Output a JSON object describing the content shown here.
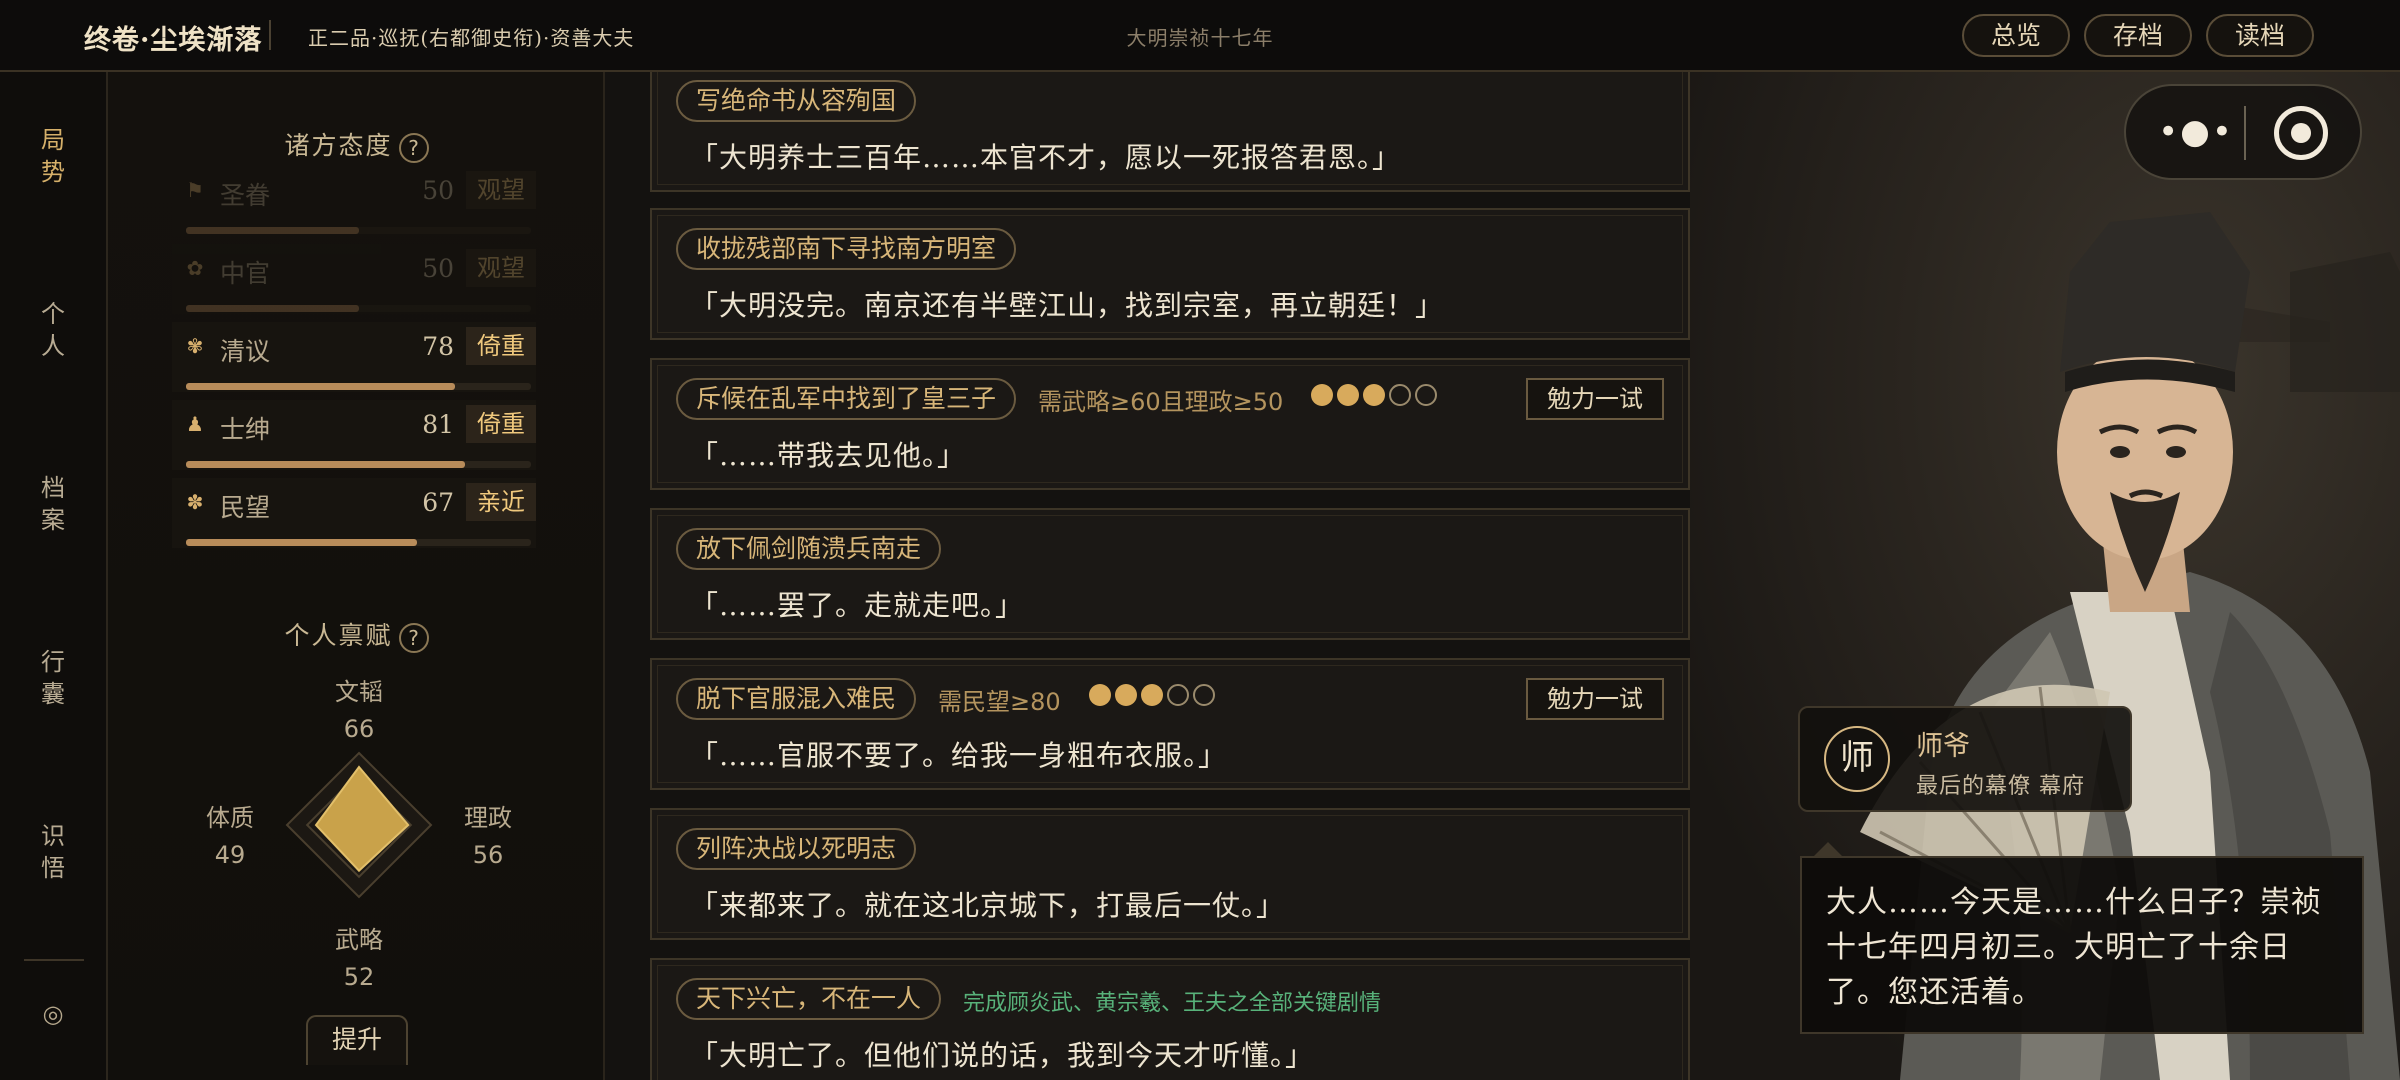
{
  "topbar": {
    "chapter": "终卷·尘埃渐落",
    "rank": "正二品·巡抚(右都御史衔)·资善大夫",
    "era": "大明崇祯十七年",
    "buttons": {
      "overview": "总览",
      "save": "存档",
      "load": "读档"
    }
  },
  "nav": {
    "items": [
      {
        "id": "situation",
        "label": "局\n势",
        "active": true
      },
      {
        "id": "personal",
        "label": "个\n人",
        "active": false
      },
      {
        "id": "archive",
        "label": "档\n案",
        "active": false
      },
      {
        "id": "baggage",
        "label": "行\n囊",
        "active": false
      },
      {
        "id": "insight",
        "label": "识\n悟",
        "active": false
      }
    ],
    "target_icon": "◎"
  },
  "attitudes": {
    "title": "诸方态度",
    "help": "?",
    "factions": [
      {
        "icon": "⚑",
        "name": "圣眷",
        "score": "50",
        "attitude": "观望",
        "level": 0.5,
        "dim": true
      },
      {
        "icon": "✿",
        "name": "中官",
        "score": "50",
        "attitude": "观望",
        "level": 0.5,
        "dim": true
      },
      {
        "icon": "✾",
        "name": "清议",
        "score": "78",
        "attitude": "倚重",
        "level": 0.78,
        "dim": false
      },
      {
        "icon": "♟",
        "name": "士绅",
        "score": "81",
        "attitude": "倚重",
        "level": 0.81,
        "dim": false
      },
      {
        "icon": "✽",
        "name": "民望",
        "score": "67",
        "attitude": "亲近",
        "level": 0.67,
        "dim": false
      }
    ]
  },
  "talents": {
    "title": "个人禀赋",
    "help": "?",
    "stats": {
      "wentao": {
        "label": "文韬",
        "value": "66"
      },
      "lizheng": {
        "label": "理政",
        "value": "56"
      },
      "wulue": {
        "label": "武略",
        "value": "52"
      },
      "tizhi": {
        "label": "体质",
        "value": "49"
      }
    },
    "upgrade": "提升"
  },
  "choices": [
    {
      "tag": "写绝命书从容殉国",
      "quote": "「大明养士三百年……本官不才，愿以一死报答君恩。」"
    },
    {
      "tag": "收拢残部南下寻找南方明室",
      "quote": "「大明没完。南京还有半壁江山，找到宗室，再立朝廷！」"
    },
    {
      "tag": "斥候在乱军中找到了皇三子",
      "requirement": "需武略≥60且理政≥50",
      "difficulty": 3,
      "difficulty_max": 5,
      "action": "勉力一试",
      "quote": "「……带我去见他。」"
    },
    {
      "tag": "放下佩剑随溃兵南走",
      "quote": "「……罢了。走就走吧。」"
    },
    {
      "tag": "脱下官服混入难民",
      "requirement": "需民望≥80",
      "difficulty": 3,
      "difficulty_max": 5,
      "action": "勉力一试",
      "quote": "「……官服不要了。给我一身粗布衣服。」"
    },
    {
      "tag": "列阵决战以死明志",
      "quote": "「来都来了。就在这北京城下，打最后一仗。」"
    },
    {
      "tag": "天下兴亡，不在一人",
      "note": "完成顾炎武、黄宗羲、王夫之全部关键剧情",
      "quote": "「大明亡了。但他们说的话，我到今天才听懂。」"
    }
  ],
  "capsule": {
    "more_icon": "•●•",
    "record_icon": "record-icon"
  },
  "npc": {
    "avatar": "师",
    "name": "师爷",
    "subtitle": "最后的幕僚  幕府",
    "dialog": "大人……今天是……什么日子？崇祯十七年四月初三。大明亡了十余日了。您还活着。"
  },
  "colors": {
    "accent": "#d8aa5c",
    "attitude_text": "#f0c97d",
    "note_green": "#58b27a"
  }
}
